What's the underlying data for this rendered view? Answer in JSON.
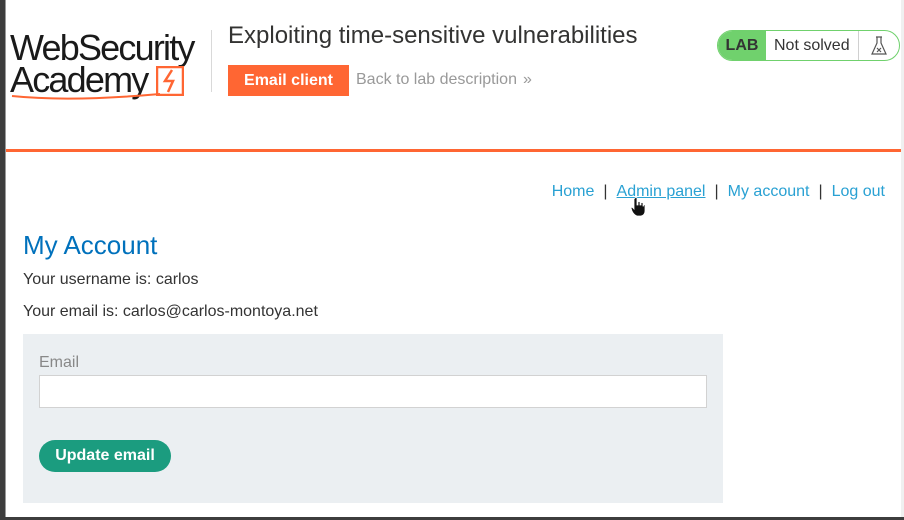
{
  "logo": {
    "line1": "WebSecurity",
    "line2": "Academy"
  },
  "lab": {
    "title": "Exploiting time-sensitive vulnerabilities",
    "email_client_label": "Email client",
    "back_label": "Back to lab description",
    "back_chevron": "»",
    "badge": "LAB",
    "status": "Not solved"
  },
  "nav": {
    "home": "Home",
    "admin": "Admin panel",
    "account": "My account",
    "logout": "Log out",
    "separator": "|"
  },
  "account": {
    "heading": "My Account",
    "username_line": "Your username is: carlos",
    "email_line": "Your email is: carlos@carlos-montoya.net"
  },
  "form": {
    "email_label": "Email",
    "email_value": "",
    "submit_label": "Update email"
  },
  "colors": {
    "accent": "#ff6633",
    "link": "#29a1d3",
    "heading": "#0071bc",
    "lab_green": "#70d16d",
    "button_green": "#1b9c7f"
  }
}
